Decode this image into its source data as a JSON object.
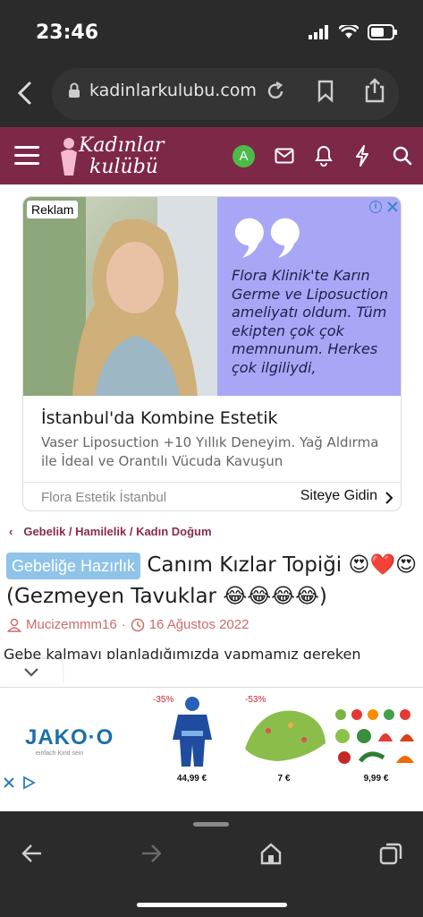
{
  "status": {
    "time": "23:46"
  },
  "browser": {
    "url": "kadinlarkulubu.com"
  },
  "site": {
    "logo_line1": "Kadınlar",
    "logo_line2": "kulübü",
    "avatar_letter": "A"
  },
  "ad": {
    "badge": "Reklam",
    "quote": "Flora Klinik'te Karın Germe ve Liposuction ameliyatı oldum. Tüm ekipten çok çok memnunum. Herkes çok ilgiliydi,",
    "title": "İstanbul'da Kombine Estetik",
    "description": "Vaser Liposuction +10 Yıllık Deneyim. Yağ Aldırma ile İdeal ve Orantılı Vücuda Kavuşun",
    "source": "Flora Estetik İstanbul",
    "cta": "Siteye Gidin"
  },
  "breadcrumb": "Gebelik / Hamilelik / Kadın Doğum",
  "topic": {
    "tag": "Gebeliğe Hazırlık",
    "title": "Canım Kızlar Topiği 😍❤️😍 (Gezmeyen Tavuklar 😂😂😂😂)"
  },
  "meta": {
    "author": "Mucizemmm16",
    "date": "16 Ağustos 2022"
  },
  "body_preview": "Gebe kalmayı planladığımızda yapmamız gereken hazırlıklar.",
  "bottom_ad": {
    "brand": "JAKO·O",
    "brand_sub": "einfach Kind sein",
    "products": [
      {
        "discount": "-35%",
        "price": "44,99 €"
      },
      {
        "discount": "-53%",
        "price": "7 €"
      },
      {
        "discount": "",
        "price": "9,99 €"
      }
    ]
  },
  "colors": {
    "nav": "#7d2846",
    "tag": "#8fc3e8",
    "accent": "#8b2a4a"
  }
}
